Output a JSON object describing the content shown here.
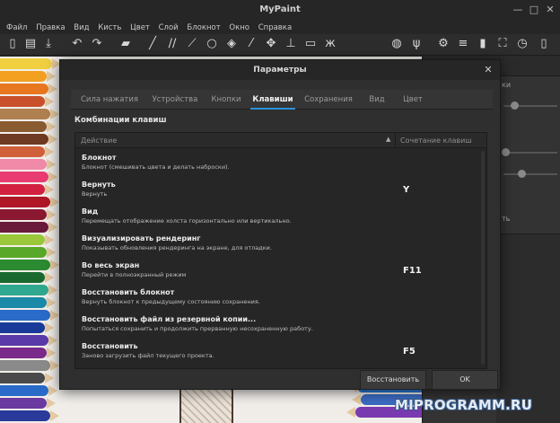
{
  "window": {
    "title": "MyPaint",
    "minimize": "—",
    "maximize": "□",
    "close": "✕"
  },
  "menu": [
    "Файл",
    "Правка",
    "Вид",
    "Кисть",
    "Цвет",
    "Слой",
    "Блокнот",
    "Окно",
    "Справка"
  ],
  "dialog": {
    "title": "Параметры",
    "close": "✕",
    "tabs": [
      "Сила нажатия",
      "Устройства",
      "Кнопки",
      "Клавиши",
      "Сохранения",
      "Вид",
      "Цвет"
    ],
    "active_tab": "Клавиши",
    "section_title": "Комбинации клавиш",
    "columns": {
      "action": "Действие",
      "shortcut": "Сочетание клавиш"
    },
    "rows": [
      {
        "name": "Блокнот",
        "desc": "Блокнот (смешивать цвета и делать наброски).",
        "key": ""
      },
      {
        "name": "Вернуть",
        "desc": "Вернуть",
        "key": "Y"
      },
      {
        "name": "Вид",
        "desc": "Перемещать отображение холста горизонтально или вертикально.",
        "key": ""
      },
      {
        "name": "Визуализировать рендеринг",
        "desc": "Показывать обновления рендеринга на экране, для отладки.",
        "key": ""
      },
      {
        "name": "Во весь экран",
        "desc": "Перейти в полноэкранный режим",
        "key": "F11"
      },
      {
        "name": "Восстановить блокнот",
        "desc": "Вернуть блокнот к предыдущему состоянию сохранения.",
        "key": ""
      },
      {
        "name": "Восстановить файл из резервной копии...",
        "desc": "Попытаться сохранить и продолжить прерванную несохраненную работу.",
        "key": ""
      },
      {
        "name": "Восстановить",
        "desc": "Заново загрузить файл текущего проекта.",
        "key": "F5"
      }
    ],
    "buttons": {
      "reset": "Восстановить",
      "ok": "OK"
    }
  },
  "side_panel": {
    "fragment_1": "ки",
    "fragment_2": "ть"
  },
  "watermark": "MIPROGRAMM.RU",
  "colors": {
    "accent": "#2a8fd8",
    "dialog_bg": "#2f2f2f",
    "list_bg": "#262626"
  }
}
